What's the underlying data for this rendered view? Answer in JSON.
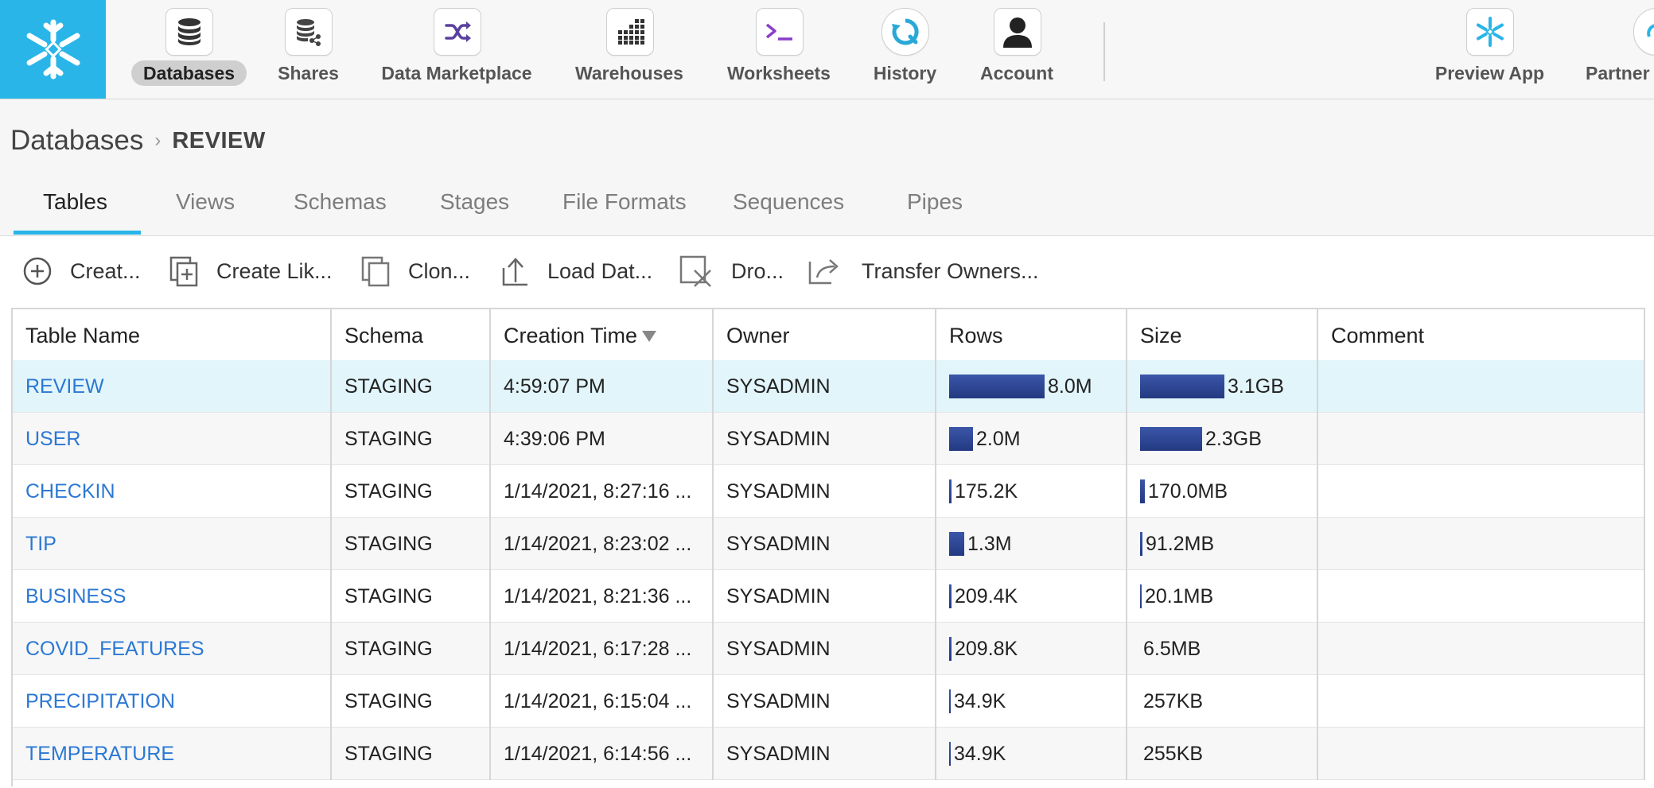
{
  "nav": {
    "items": [
      {
        "label": "Databases",
        "icon": "database-icon",
        "active": true
      },
      {
        "label": "Shares",
        "icon": "share-icon"
      },
      {
        "label": "Data Marketplace",
        "icon": "shuffle-icon"
      },
      {
        "label": "Warehouses",
        "icon": "warehouse-grid-icon"
      },
      {
        "label": "Worksheets",
        "icon": "terminal-icon"
      },
      {
        "label": "History",
        "icon": "history-icon"
      },
      {
        "label": "Account",
        "icon": "account-icon"
      }
    ],
    "right_items": [
      {
        "label": "Preview App",
        "icon": "snowflake-icon"
      },
      {
        "label": "Partner",
        "icon": "partner-icon"
      }
    ]
  },
  "breadcrumb": {
    "root": "Databases",
    "current": "REVIEW"
  },
  "tabs": [
    "Tables",
    "Views",
    "Schemas",
    "Stages",
    "File Formats",
    "Sequences",
    "Pipes"
  ],
  "toolbar": {
    "create": "Creat...",
    "create_like": "Create Lik...",
    "clone": "Clon...",
    "load_data": "Load Dat...",
    "drop": "Dro...",
    "transfer": "Transfer Owners..."
  },
  "table": {
    "columns": [
      "Table Name",
      "Schema",
      "Creation Time",
      "Owner",
      "Rows",
      "Size",
      "Comment"
    ],
    "rows": [
      {
        "name": "REVIEW",
        "schema": "STAGING",
        "created": "4:59:07 PM",
        "owner": "SYSADMIN",
        "rows": "8.0M",
        "rows_frac": 1.0,
        "size": "3.1GB",
        "size_frac": 1.0,
        "comment": ""
      },
      {
        "name": "USER",
        "schema": "STAGING",
        "created": "4:39:06 PM",
        "owner": "SYSADMIN",
        "rows": "2.0M",
        "rows_frac": 0.25,
        "size": "2.3GB",
        "size_frac": 0.74,
        "comment": ""
      },
      {
        "name": "CHECKIN",
        "schema": "STAGING",
        "created": "1/14/2021, 8:27:16 ...",
        "owner": "SYSADMIN",
        "rows": "175.2K",
        "rows_frac": 0.022,
        "size": "170.0MB",
        "size_frac": 0.055,
        "comment": ""
      },
      {
        "name": "TIP",
        "schema": "STAGING",
        "created": "1/14/2021, 8:23:02 ...",
        "owner": "SYSADMIN",
        "rows": "1.3M",
        "rows_frac": 0.16,
        "size": "91.2MB",
        "size_frac": 0.029,
        "comment": ""
      },
      {
        "name": "BUSINESS",
        "schema": "STAGING",
        "created": "1/14/2021, 8:21:36 ...",
        "owner": "SYSADMIN",
        "rows": "209.4K",
        "rows_frac": 0.026,
        "size": "20.1MB",
        "size_frac": 0.0065,
        "comment": ""
      },
      {
        "name": "COVID_FEATURES",
        "schema": "STAGING",
        "created": "1/14/2021, 6:17:28 ...",
        "owner": "SYSADMIN",
        "rows": "209.8K",
        "rows_frac": 0.026,
        "size": "6.5MB",
        "size_frac": 0.002,
        "comment": ""
      },
      {
        "name": "PRECIPITATION",
        "schema": "STAGING",
        "created": "1/14/2021, 6:15:04 ...",
        "owner": "SYSADMIN",
        "rows": "34.9K",
        "rows_frac": 0.0044,
        "size": "257KB",
        "size_frac": 0.0001,
        "comment": ""
      },
      {
        "name": "TEMPERATURE",
        "schema": "STAGING",
        "created": "1/14/2021, 6:14:56 ...",
        "owner": "SYSADMIN",
        "rows": "34.9K",
        "rows_frac": 0.0044,
        "size": "255KB",
        "size_frac": 0.0001,
        "comment": ""
      }
    ]
  },
  "colors": {
    "accent": "#29b5e8",
    "link": "#2b78d4",
    "bar": "#2f4a96",
    "selected_row": "#e1f5fa"
  }
}
